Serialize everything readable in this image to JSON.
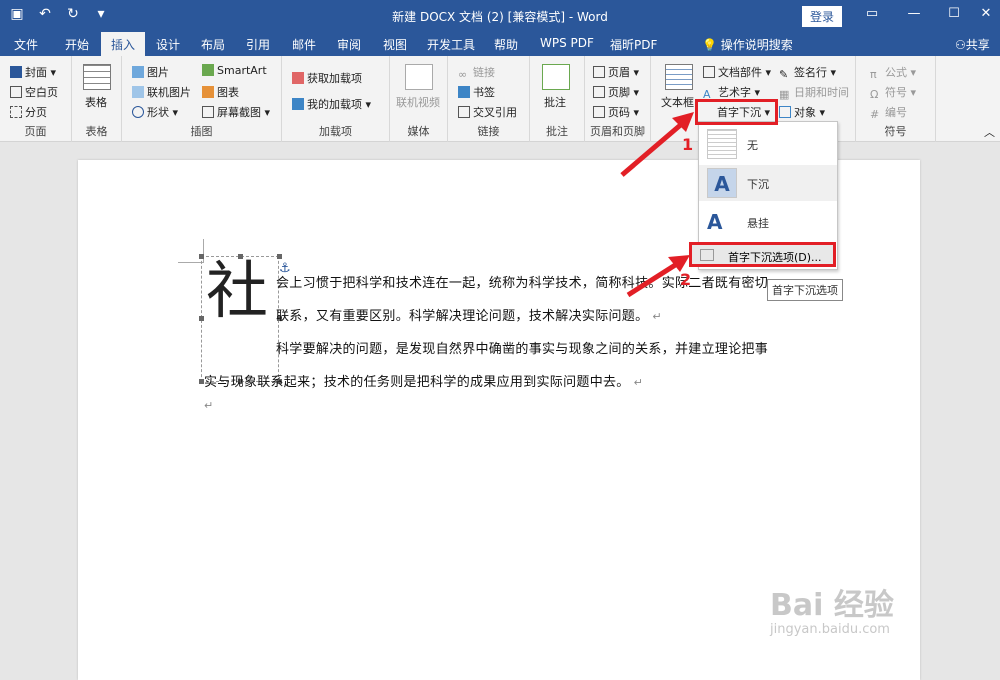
{
  "titlebar": {
    "title": "新建 DOCX 文档 (2) [兼容模式] - Word",
    "login": "登录",
    "qat": [
      "save-icon",
      "undo-icon",
      "redo-icon",
      "customize-icon"
    ]
  },
  "tabs": [
    "文件",
    "开始",
    "插入",
    "设计",
    "布局",
    "引用",
    "邮件",
    "审阅",
    "视图",
    "开发工具",
    "帮助",
    "WPS PDF",
    "福昕PDF"
  ],
  "active_tab": "插入",
  "tellme": "操作说明搜索",
  "share": "共享",
  "ribbon": {
    "pages": {
      "items": [
        "封面",
        "空白页",
        "分页"
      ],
      "label": "页面"
    },
    "tables": {
      "item": "表格",
      "label": "表格"
    },
    "illustrations": {
      "items": [
        "图片",
        "联机图片",
        "形状",
        "SmartArt",
        "图表",
        "屏幕截图"
      ],
      "label": "插图"
    },
    "addins": {
      "items": [
        "获取加载项",
        "我的加载项"
      ],
      "label": "加载项"
    },
    "media": {
      "item": "联机视频",
      "label": "媒体"
    },
    "links": {
      "items": [
        "链接",
        "书签",
        "交叉引用"
      ],
      "label": "链接"
    },
    "comments": {
      "item": "批注",
      "label": "批注"
    },
    "headerfooter": {
      "items": [
        "页眉",
        "页脚",
        "页码"
      ],
      "label": "页眉和页脚"
    },
    "text": {
      "items": [
        "文本框",
        "文档部件",
        "艺术字",
        "首字下沉",
        "签名行",
        "日期和时间",
        "对象"
      ]
    },
    "symbols": {
      "items": [
        "公式",
        "符号",
        "编号"
      ],
      "label": "符号"
    }
  },
  "document": {
    "dropcap": "社",
    "lines": [
      "会上习惯于把科学和技术连在一起，统称为科学技术，简称科技。实际二者既有密切",
      "联系，又有重要区别。科学解决理论问题，技术解决实际问题。",
      "科学要解决的问题，是发现自然界中确凿的事实与现象之间的关系，并建立理论把事",
      "实与现象联系起来；技术的任务则是把科学的成果应用到实际问题中去。"
    ]
  },
  "dropdown": {
    "options": [
      "无",
      "下沉",
      "悬挂"
    ],
    "more": "首字下沉选项(D)...",
    "tooltip": "首字下沉选项"
  },
  "annotations": {
    "step1": "1",
    "step2": "2"
  },
  "watermark": {
    "logo": "Bai 经验",
    "url": "jingyan.baidu.com"
  },
  "colors": {
    "accent": "#2b579a",
    "highlight": "#e21f26"
  }
}
